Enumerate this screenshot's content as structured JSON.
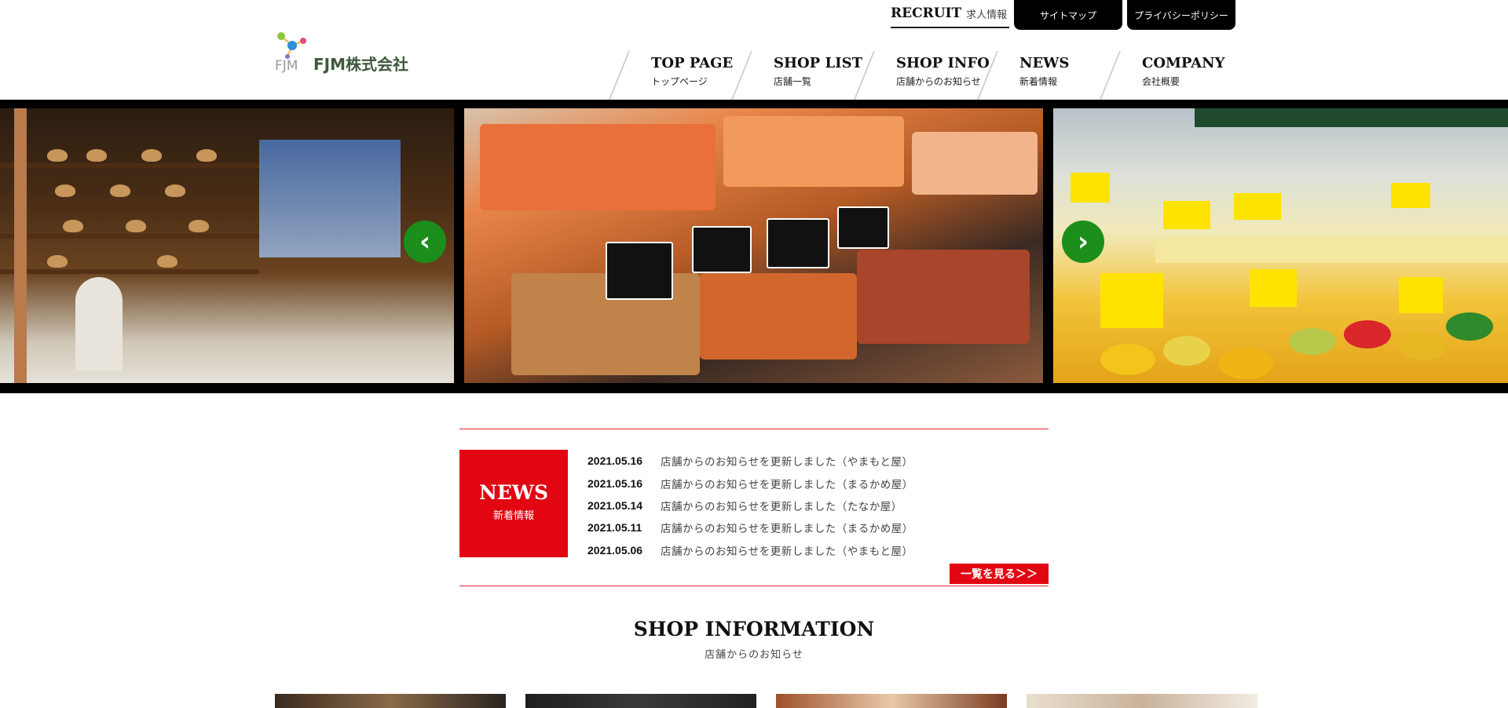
{
  "header": {
    "logo_text": "FJM株式会社",
    "logo_mark": "FJM",
    "recruit_en": "RECRUIT",
    "recruit_ja": "求人情報",
    "sitemap": "サイトマップ",
    "privacy": "プライバシーポリシー"
  },
  "nav": [
    {
      "en": "TOP PAGE",
      "ja": "トップページ"
    },
    {
      "en": "SHOP LIST",
      "ja": "店舗一覧"
    },
    {
      "en": "SHOP INFO",
      "ja": "店舗からのお知らせ"
    },
    {
      "en": "NEWS",
      "ja": "新着情報"
    },
    {
      "en": "COMPANY",
      "ja": "会社概要"
    }
  ],
  "slider": {
    "prev_icon": "chevron-left-icon",
    "next_icon": "chevron-right-icon",
    "prev_glyph": "‹",
    "next_glyph": "›",
    "arrow_color": "#1b8e1b"
  },
  "news": {
    "title_en": "NEWS",
    "title_ja": "新着情報",
    "items": [
      {
        "date": "2021.05.16",
        "text": "店舗からのお知らせを更新しました（やまもと屋）"
      },
      {
        "date": "2021.05.16",
        "text": "店舗からのお知らせを更新しました（まるかめ屋）"
      },
      {
        "date": "2021.05.14",
        "text": "店舗からのお知らせを更新しました（たなか屋）"
      },
      {
        "date": "2021.05.11",
        "text": "店舗からのお知らせを更新しました（まるかめ屋）"
      },
      {
        "date": "2021.05.06",
        "text": "店舗からのお知らせを更新しました（やまもと屋）"
      }
    ],
    "more": "一覧を見る＞＞",
    "accent": "#e20613"
  },
  "shop_info": {
    "title": "SHOP INFORMATION",
    "subtitle": "店舗からのお知らせ"
  }
}
